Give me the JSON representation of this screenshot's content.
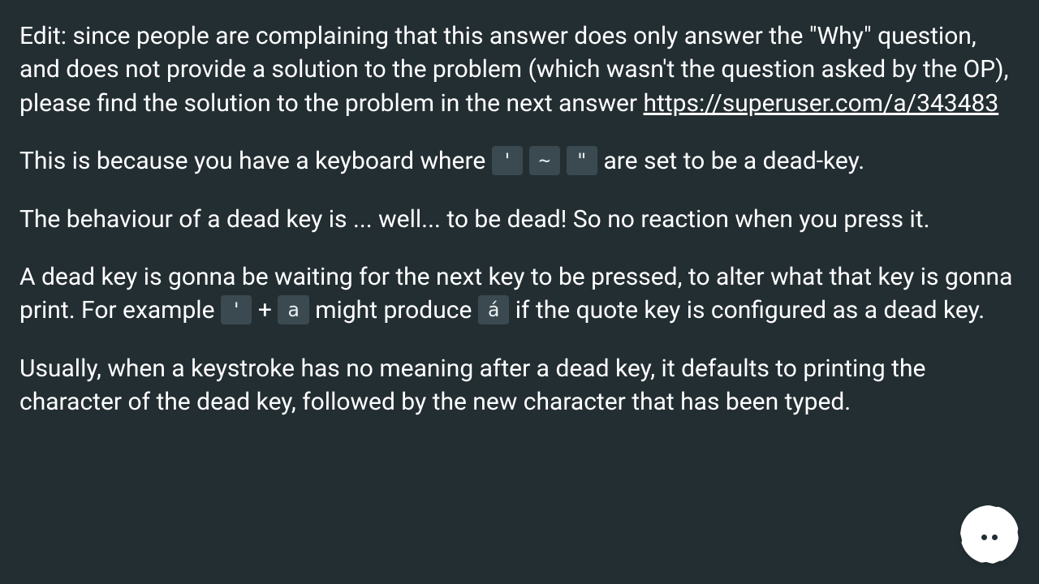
{
  "paragraphs": {
    "p1_pre": "Edit: since people are complaining that this answer does only answer the \"Why\" question, and does not provide a solution to the problem (which wasn't the question asked by the OP), please find the solution to the problem in the next answer ",
    "p1_link_text": "https://superuser.com/a/343483",
    "p1_link_href": "https://superuser.com/a/343483",
    "p2_pre": "This is because you have a keyboard where ",
    "p2_kbd1": "'",
    "p2_kbd2": "~",
    "p2_kbd3": "\"",
    "p2_post": " are set to be a dead-key.",
    "p3": "The behaviour of a dead key is ... well... to be dead! So no reaction when you press it.",
    "p4_pre": "A dead key is gonna be waiting for the next key to be pressed, to alter what that key is gonna print. For example ",
    "p4_kbd1": "'",
    "p4_plus": " + ",
    "p4_kbd2": "a",
    "p4_mid": " might produce ",
    "p4_kbd3": "á",
    "p4_post": " if the quote key is configured as a dead key.",
    "p5": "Usually, when a keystroke has no meaning after a dead key, it defaults to printing the character of the dead key, followed by the new character that has been typed."
  }
}
